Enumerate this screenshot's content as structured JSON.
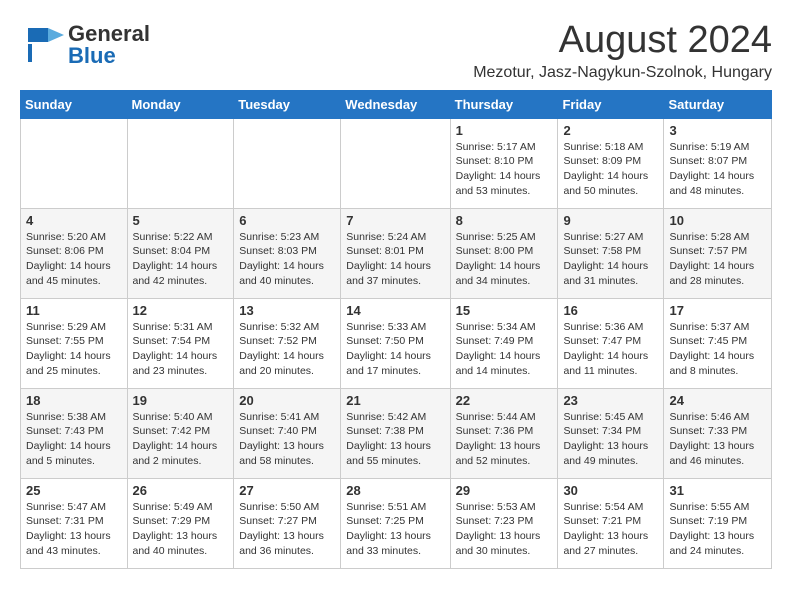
{
  "header": {
    "logo": {
      "general": "General",
      "blue": "Blue"
    },
    "title": "August 2024",
    "location": "Mezotur, Jasz-Nagykun-Szolnok, Hungary"
  },
  "weekdays": [
    "Sunday",
    "Monday",
    "Tuesday",
    "Wednesday",
    "Thursday",
    "Friday",
    "Saturday"
  ],
  "weeks": [
    [
      {
        "day": "",
        "info": ""
      },
      {
        "day": "",
        "info": ""
      },
      {
        "day": "",
        "info": ""
      },
      {
        "day": "",
        "info": ""
      },
      {
        "day": "1",
        "info": "Sunrise: 5:17 AM\nSunset: 8:10 PM\nDaylight: 14 hours\nand 53 minutes."
      },
      {
        "day": "2",
        "info": "Sunrise: 5:18 AM\nSunset: 8:09 PM\nDaylight: 14 hours\nand 50 minutes."
      },
      {
        "day": "3",
        "info": "Sunrise: 5:19 AM\nSunset: 8:07 PM\nDaylight: 14 hours\nand 48 minutes."
      }
    ],
    [
      {
        "day": "4",
        "info": "Sunrise: 5:20 AM\nSunset: 8:06 PM\nDaylight: 14 hours\nand 45 minutes."
      },
      {
        "day": "5",
        "info": "Sunrise: 5:22 AM\nSunset: 8:04 PM\nDaylight: 14 hours\nand 42 minutes."
      },
      {
        "day": "6",
        "info": "Sunrise: 5:23 AM\nSunset: 8:03 PM\nDaylight: 14 hours\nand 40 minutes."
      },
      {
        "day": "7",
        "info": "Sunrise: 5:24 AM\nSunset: 8:01 PM\nDaylight: 14 hours\nand 37 minutes."
      },
      {
        "day": "8",
        "info": "Sunrise: 5:25 AM\nSunset: 8:00 PM\nDaylight: 14 hours\nand 34 minutes."
      },
      {
        "day": "9",
        "info": "Sunrise: 5:27 AM\nSunset: 7:58 PM\nDaylight: 14 hours\nand 31 minutes."
      },
      {
        "day": "10",
        "info": "Sunrise: 5:28 AM\nSunset: 7:57 PM\nDaylight: 14 hours\nand 28 minutes."
      }
    ],
    [
      {
        "day": "11",
        "info": "Sunrise: 5:29 AM\nSunset: 7:55 PM\nDaylight: 14 hours\nand 25 minutes."
      },
      {
        "day": "12",
        "info": "Sunrise: 5:31 AM\nSunset: 7:54 PM\nDaylight: 14 hours\nand 23 minutes."
      },
      {
        "day": "13",
        "info": "Sunrise: 5:32 AM\nSunset: 7:52 PM\nDaylight: 14 hours\nand 20 minutes."
      },
      {
        "day": "14",
        "info": "Sunrise: 5:33 AM\nSunset: 7:50 PM\nDaylight: 14 hours\nand 17 minutes."
      },
      {
        "day": "15",
        "info": "Sunrise: 5:34 AM\nSunset: 7:49 PM\nDaylight: 14 hours\nand 14 minutes."
      },
      {
        "day": "16",
        "info": "Sunrise: 5:36 AM\nSunset: 7:47 PM\nDaylight: 14 hours\nand 11 minutes."
      },
      {
        "day": "17",
        "info": "Sunrise: 5:37 AM\nSunset: 7:45 PM\nDaylight: 14 hours\nand 8 minutes."
      }
    ],
    [
      {
        "day": "18",
        "info": "Sunrise: 5:38 AM\nSunset: 7:43 PM\nDaylight: 14 hours\nand 5 minutes."
      },
      {
        "day": "19",
        "info": "Sunrise: 5:40 AM\nSunset: 7:42 PM\nDaylight: 14 hours\nand 2 minutes."
      },
      {
        "day": "20",
        "info": "Sunrise: 5:41 AM\nSunset: 7:40 PM\nDaylight: 13 hours\nand 58 minutes."
      },
      {
        "day": "21",
        "info": "Sunrise: 5:42 AM\nSunset: 7:38 PM\nDaylight: 13 hours\nand 55 minutes."
      },
      {
        "day": "22",
        "info": "Sunrise: 5:44 AM\nSunset: 7:36 PM\nDaylight: 13 hours\nand 52 minutes."
      },
      {
        "day": "23",
        "info": "Sunrise: 5:45 AM\nSunset: 7:34 PM\nDaylight: 13 hours\nand 49 minutes."
      },
      {
        "day": "24",
        "info": "Sunrise: 5:46 AM\nSunset: 7:33 PM\nDaylight: 13 hours\nand 46 minutes."
      }
    ],
    [
      {
        "day": "25",
        "info": "Sunrise: 5:47 AM\nSunset: 7:31 PM\nDaylight: 13 hours\nand 43 minutes."
      },
      {
        "day": "26",
        "info": "Sunrise: 5:49 AM\nSunset: 7:29 PM\nDaylight: 13 hours\nand 40 minutes."
      },
      {
        "day": "27",
        "info": "Sunrise: 5:50 AM\nSunset: 7:27 PM\nDaylight: 13 hours\nand 36 minutes."
      },
      {
        "day": "28",
        "info": "Sunrise: 5:51 AM\nSunset: 7:25 PM\nDaylight: 13 hours\nand 33 minutes."
      },
      {
        "day": "29",
        "info": "Sunrise: 5:53 AM\nSunset: 7:23 PM\nDaylight: 13 hours\nand 30 minutes."
      },
      {
        "day": "30",
        "info": "Sunrise: 5:54 AM\nSunset: 7:21 PM\nDaylight: 13 hours\nand 27 minutes."
      },
      {
        "day": "31",
        "info": "Sunrise: 5:55 AM\nSunset: 7:19 PM\nDaylight: 13 hours\nand 24 minutes."
      }
    ]
  ]
}
